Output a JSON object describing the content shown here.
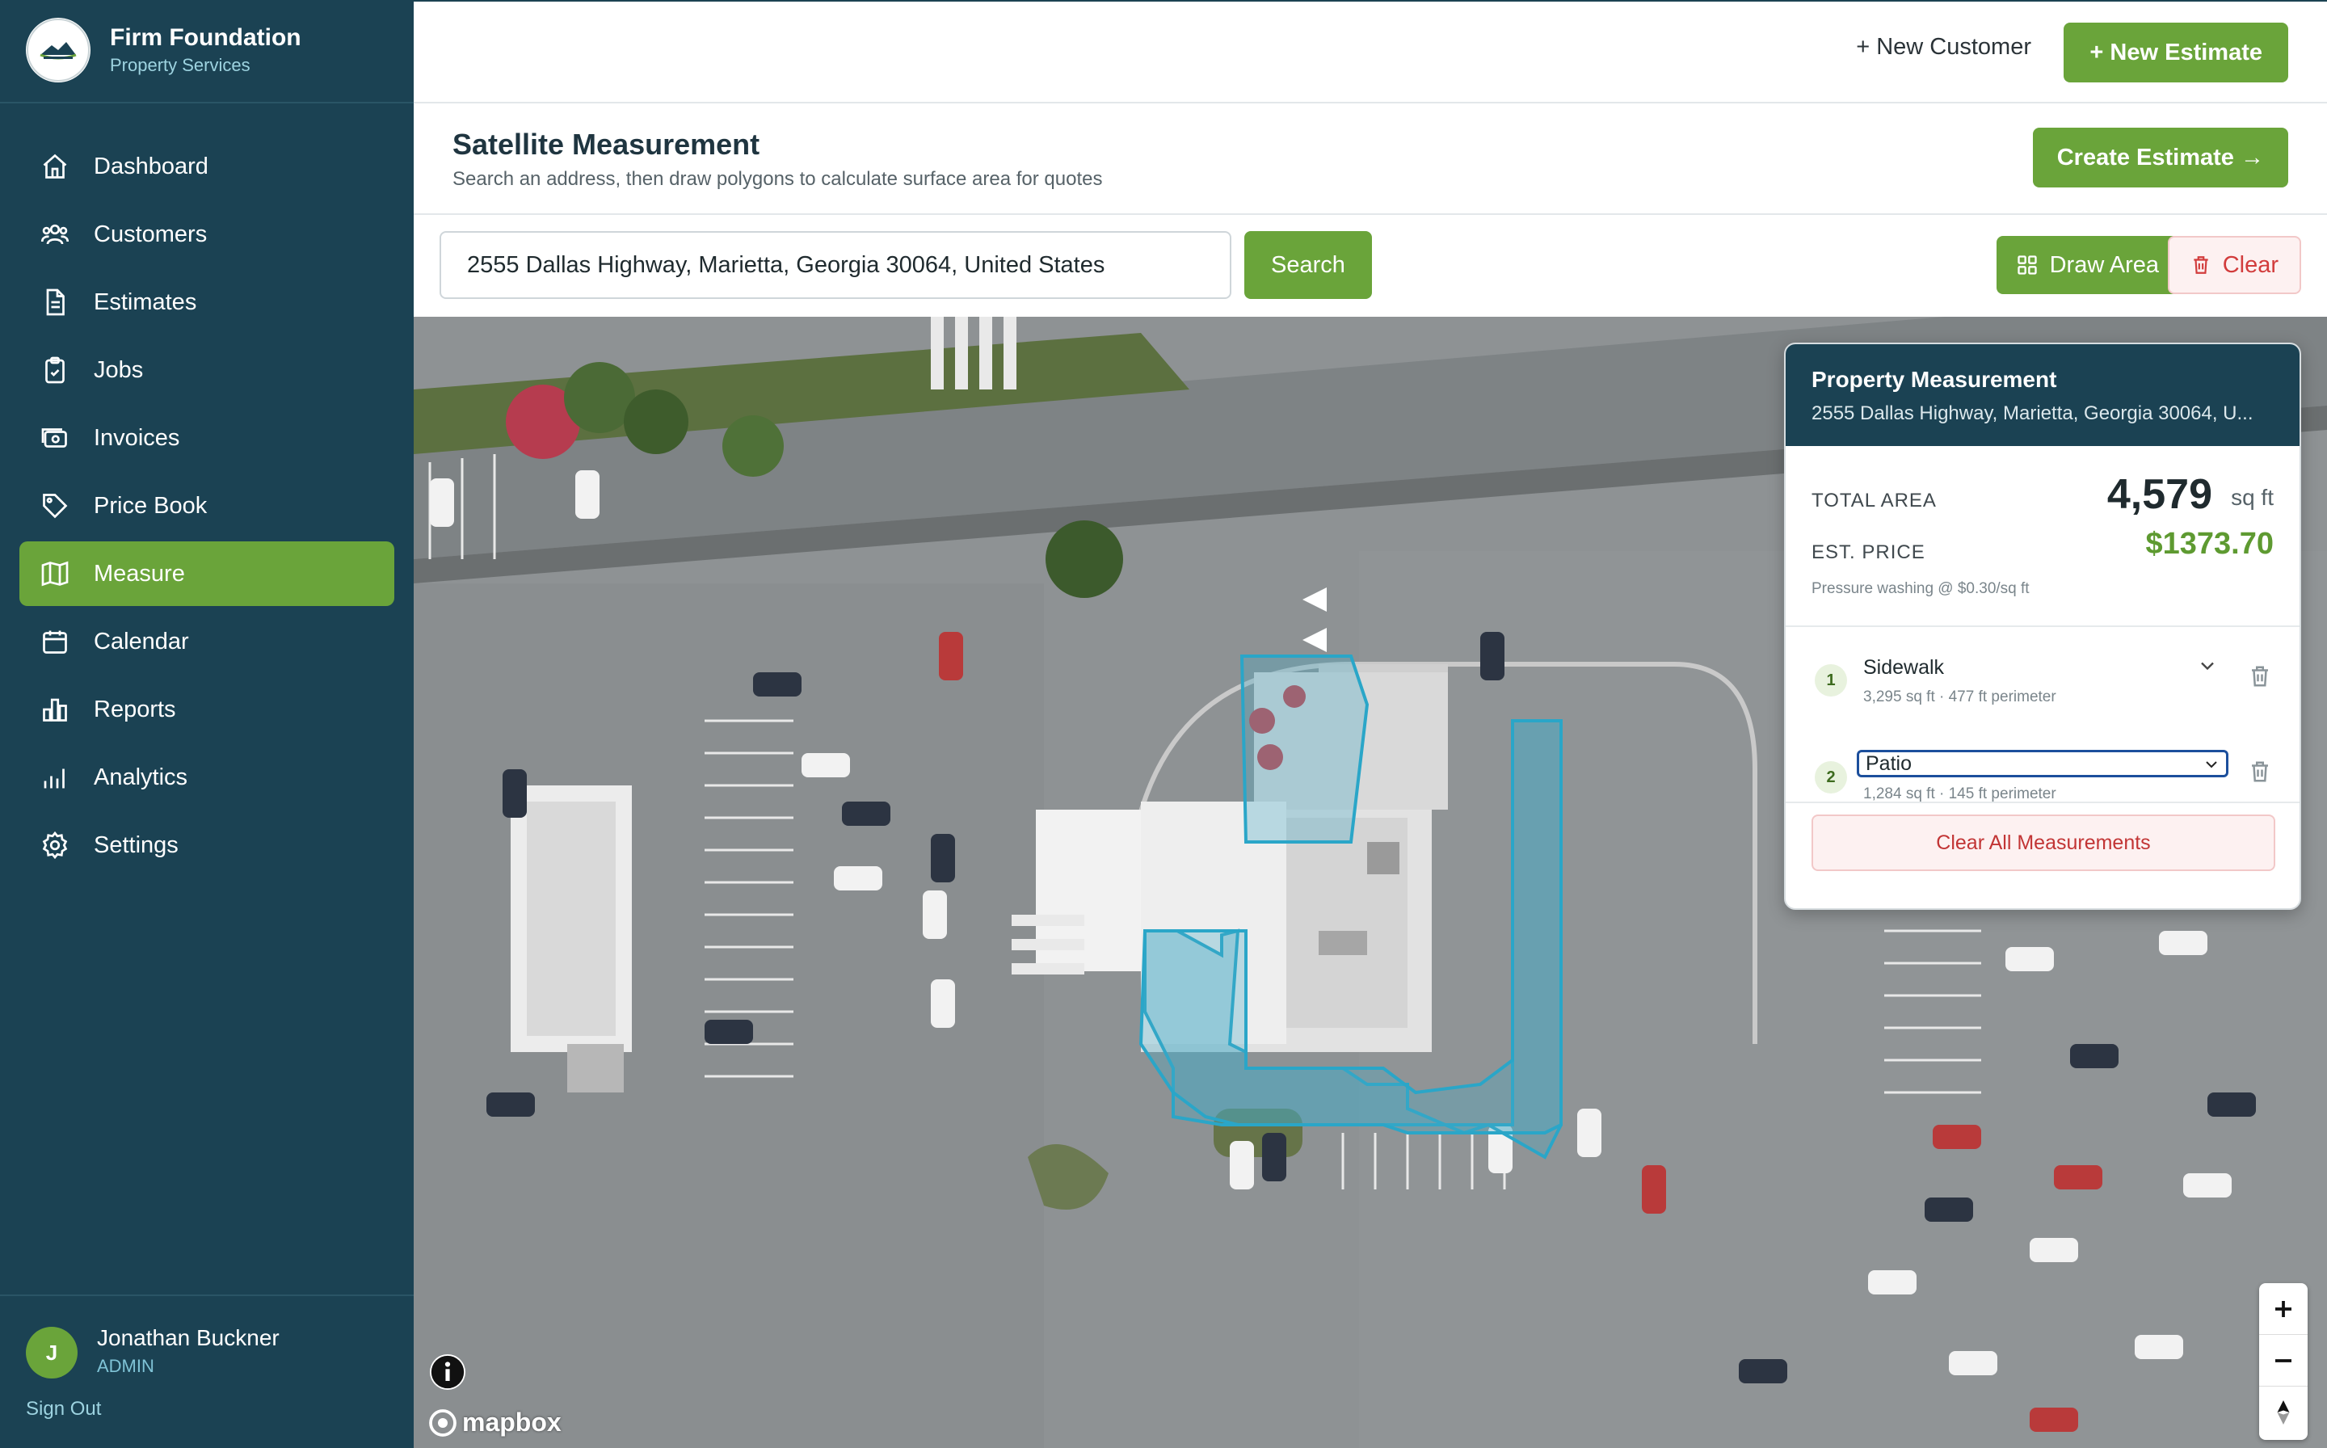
{
  "brand": {
    "name": "Firm Foundation",
    "subtitle": "Property Services"
  },
  "sidebar": {
    "items": [
      {
        "label": "Dashboard",
        "icon": "home-icon"
      },
      {
        "label": "Customers",
        "icon": "users-icon"
      },
      {
        "label": "Estimates",
        "icon": "document-icon"
      },
      {
        "label": "Jobs",
        "icon": "clipboard-icon"
      },
      {
        "label": "Invoices",
        "icon": "cash-icon"
      },
      {
        "label": "Price Book",
        "icon": "tag-icon"
      },
      {
        "label": "Measure",
        "icon": "map-icon",
        "active": true
      },
      {
        "label": "Calendar",
        "icon": "calendar-icon"
      },
      {
        "label": "Reports",
        "icon": "bar-chart-icon"
      },
      {
        "label": "Analytics",
        "icon": "analytics-icon"
      },
      {
        "label": "Settings",
        "icon": "gear-icon"
      }
    ]
  },
  "user": {
    "initial": "J",
    "name": "Jonathan Buckner",
    "role": "ADMIN",
    "sign_out": "Sign Out"
  },
  "topbar": {
    "new_customer": "+ New Customer",
    "new_estimate": "+ New Estimate"
  },
  "page": {
    "title": "Satellite Measurement",
    "subtitle": "Search an address, then draw polygons to calculate surface area for quotes",
    "create_estimate": "Create Estimate →"
  },
  "search": {
    "value": "2555 Dallas Highway, Marietta, Georgia 30064, United States",
    "button": "Search",
    "draw_area": "Draw Area",
    "clear": "Clear"
  },
  "panel": {
    "title": "Property Measurement",
    "address": "2555 Dallas Highway, Marietta, Georgia 30064, U...",
    "total_label": "TOTAL AREA",
    "total_value": "4,579",
    "total_unit": "sq ft",
    "price_label": "EST. PRICE",
    "price_value": "$1373.70",
    "price_note": "Pressure washing @ $0.30/sq ft",
    "measurements": [
      {
        "num": "1",
        "name": "Sidewalk",
        "detail": "3,295 sq ft · 477 ft perimeter"
      },
      {
        "num": "2",
        "name": "Patio",
        "detail": "1,284 sq ft · 145 ft perimeter"
      }
    ],
    "clear_all": "Clear All Measurements"
  },
  "map": {
    "attribution": "mapbox",
    "zoom_in": "+",
    "zoom_out": "−"
  },
  "colors": {
    "sidebar": "#1b4253",
    "accent_green": "#6aa43a",
    "danger": "#d23c3c",
    "polygon": "#2aa6c8"
  }
}
